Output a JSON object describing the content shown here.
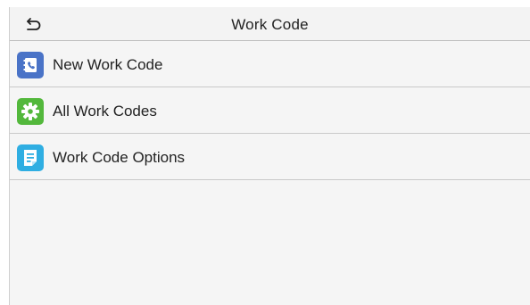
{
  "header": {
    "title": "Work Code",
    "back_icon": "back-arrow-icon"
  },
  "menu": {
    "items": [
      {
        "label": "New Work Code",
        "icon": "phone-book-icon",
        "icon_color": "#4a73c7"
      },
      {
        "label": "All Work Codes",
        "icon": "gear-icon",
        "icon_color": "#53b83c"
      },
      {
        "label": "Work Code Options",
        "icon": "document-icon",
        "icon_color": "#2faee2"
      }
    ]
  }
}
